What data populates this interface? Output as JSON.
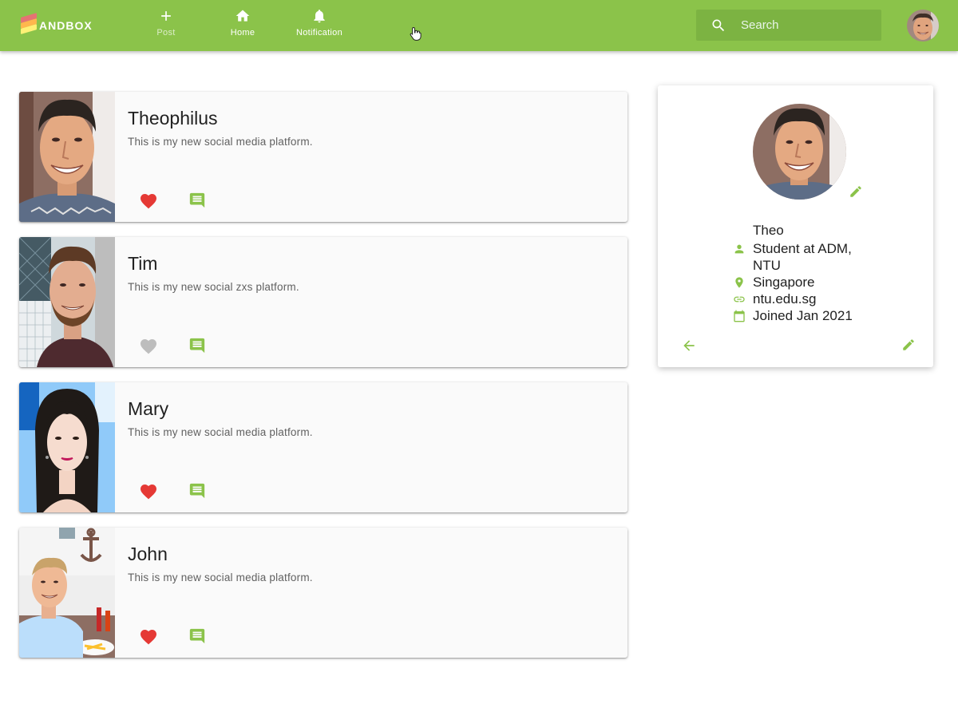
{
  "app": {
    "logo_text": "ANDBOX",
    "colors": {
      "primary": "#8bc34a",
      "primary_dark": "#7cb342",
      "like_active": "#e53935",
      "like_inactive": "#bdbdbd",
      "icon_green": "#8bc34a"
    }
  },
  "nav": {
    "post_label": "Post",
    "home_label": "Home",
    "notification_label": "Notification"
  },
  "search": {
    "placeholder": "Search"
  },
  "feed": [
    {
      "name": "Theophilus",
      "body": "This is my new social media platform.",
      "liked": true
    },
    {
      "name": "Tim",
      "body": "This is my new social zxs platform.",
      "liked": false
    },
    {
      "name": "Mary",
      "body": "This is my new social media platform.",
      "liked": true
    },
    {
      "name": "John",
      "body": "This is my new social media platform.",
      "liked": true
    }
  ],
  "profile": {
    "handle": "Theo",
    "bio": "Student at ADM, NTU",
    "location": "Singapore",
    "website": "ntu.edu.sg",
    "joined": "Joined Jan 2021",
    "icons": [
      "person-icon",
      "location-pin-icon",
      "link-icon",
      "calendar-icon",
      "edit-icon",
      "back-arrow-icon"
    ]
  }
}
